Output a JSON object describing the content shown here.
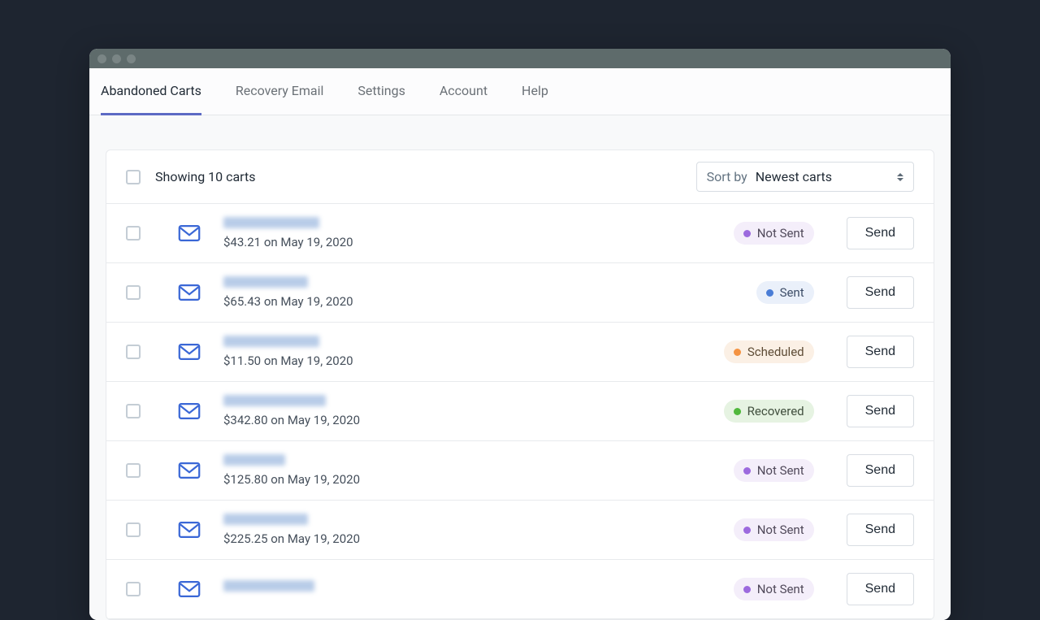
{
  "tabs": [
    {
      "label": "Abandoned Carts",
      "active": true
    },
    {
      "label": "Recovery Email",
      "active": false
    },
    {
      "label": "Settings",
      "active": false
    },
    {
      "label": "Account",
      "active": false
    },
    {
      "label": "Help",
      "active": false
    }
  ],
  "header": {
    "showing_text": "Showing 10 carts",
    "sort_label": "Sort by",
    "sort_value": "Newest carts"
  },
  "send_label": "Send",
  "status_labels": {
    "not_sent": "Not Sent",
    "sent": "Sent",
    "scheduled": "Scheduled",
    "recovered": "Recovered"
  },
  "rows": [
    {
      "name_width": 118,
      "amount": "$43.21",
      "date": "May 19, 2020",
      "status": "not_sent"
    },
    {
      "name_width": 104,
      "amount": "$65.43",
      "date": "May 19, 2020",
      "status": "sent"
    },
    {
      "name_width": 118,
      "amount": "$11.50",
      "date": "May 19, 2020",
      "status": "scheduled"
    },
    {
      "name_width": 126,
      "amount": "$342.80",
      "date": "May 19, 2020",
      "status": "recovered"
    },
    {
      "name_width": 76,
      "amount": "$125.80",
      "date": "May 19, 2020",
      "status": "not_sent"
    },
    {
      "name_width": 104,
      "amount": "$225.25",
      "date": "May 19, 2020",
      "status": "not_sent"
    },
    {
      "name_width": 112,
      "amount": "",
      "date": "",
      "status": "not_sent"
    }
  ]
}
